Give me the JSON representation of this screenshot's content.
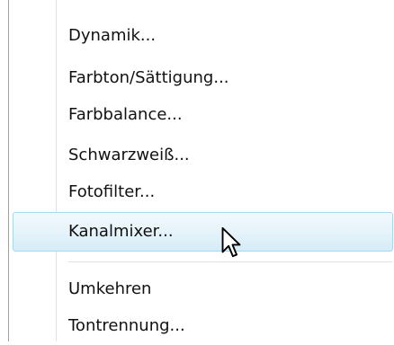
{
  "menu": {
    "items": [
      {
        "label": "Dynamik..."
      },
      {
        "label": "Farbton/Sättigung..."
      },
      {
        "label": "Farbbalance..."
      },
      {
        "label": "Schwarzweiß..."
      },
      {
        "label": "Fotofilter..."
      },
      {
        "label": "Kanalmixer...",
        "highlighted": true
      },
      {
        "label": "Umkehren"
      },
      {
        "label": "Tontrennung..."
      }
    ]
  },
  "cursor": {
    "icon": "arrow-cursor-icon"
  },
  "colors": {
    "highlight_border": "#a8d8eb",
    "highlight_fill": "#e6f3fa",
    "text": "#111111",
    "separator": "#e0e0e0"
  }
}
